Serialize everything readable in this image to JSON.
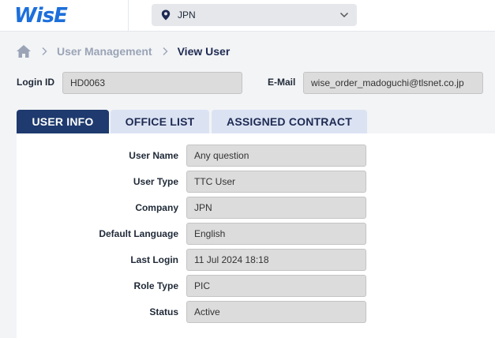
{
  "header": {
    "logo": "WisE",
    "country": "JPN"
  },
  "breadcrumb": {
    "parent": "User Management",
    "current": "View User"
  },
  "login": {
    "label": "Login ID",
    "value": "HD0063"
  },
  "email": {
    "label": "E-Mail",
    "value": "wise_order_madoguchi@tlsnet.co.jp"
  },
  "tabs": [
    {
      "label": "USER INFO",
      "active": true
    },
    {
      "label": "OFFICE LIST",
      "active": false
    },
    {
      "label": "ASSIGNED CONTRACT",
      "active": false
    }
  ],
  "user_info": {
    "rows": [
      {
        "label": "User Name",
        "value": "Any question"
      },
      {
        "label": "User Type",
        "value": "TTC User"
      },
      {
        "label": "Company",
        "value": "JPN"
      },
      {
        "label": "Default Language",
        "value": "English"
      },
      {
        "label": "Last Login",
        "value": "11 Jul 2024 18:18"
      },
      {
        "label": "Role Type",
        "value": "PIC"
      },
      {
        "label": "Status",
        "value": "Active"
      }
    ]
  },
  "colors": {
    "brand": "#1d6fdb",
    "tab_active": "#1e3a6e",
    "tab_inactive": "#dbe3f3",
    "field_bg": "#dcdcdc"
  },
  "icons": {
    "home": "home-icon",
    "location": "map-pin-icon",
    "dropdown": "chevron-down-icon",
    "separator": "chevron-right-icon"
  }
}
